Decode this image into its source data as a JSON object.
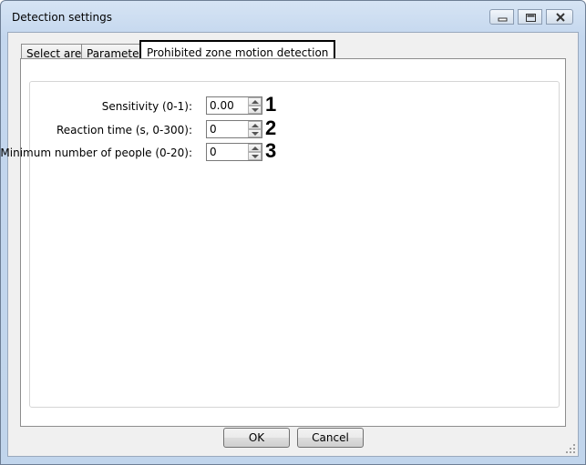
{
  "window": {
    "title": "Detection settings"
  },
  "tabs": [
    {
      "label": "Select area"
    },
    {
      "label": "Parameters"
    },
    {
      "label": "Prohibited zone motion detection"
    }
  ],
  "fields": [
    {
      "label": "Sensitivity (0-1):",
      "value": "0.00",
      "marker": "1"
    },
    {
      "label": "Reaction time (s, 0-300):",
      "value": "0",
      "marker": "2"
    },
    {
      "label": "Minimum number of people (0-20):",
      "value": "0",
      "marker": "3"
    }
  ],
  "buttons": {
    "ok": "OK",
    "cancel": "Cancel"
  },
  "icons": {
    "minimize": "minimize-icon",
    "maximize": "maximize-icon",
    "close": "close-icon",
    "spin_up": "arrow-up-icon",
    "spin_down": "arrow-down-icon",
    "resize_grip": "resize-grip-icon"
  }
}
